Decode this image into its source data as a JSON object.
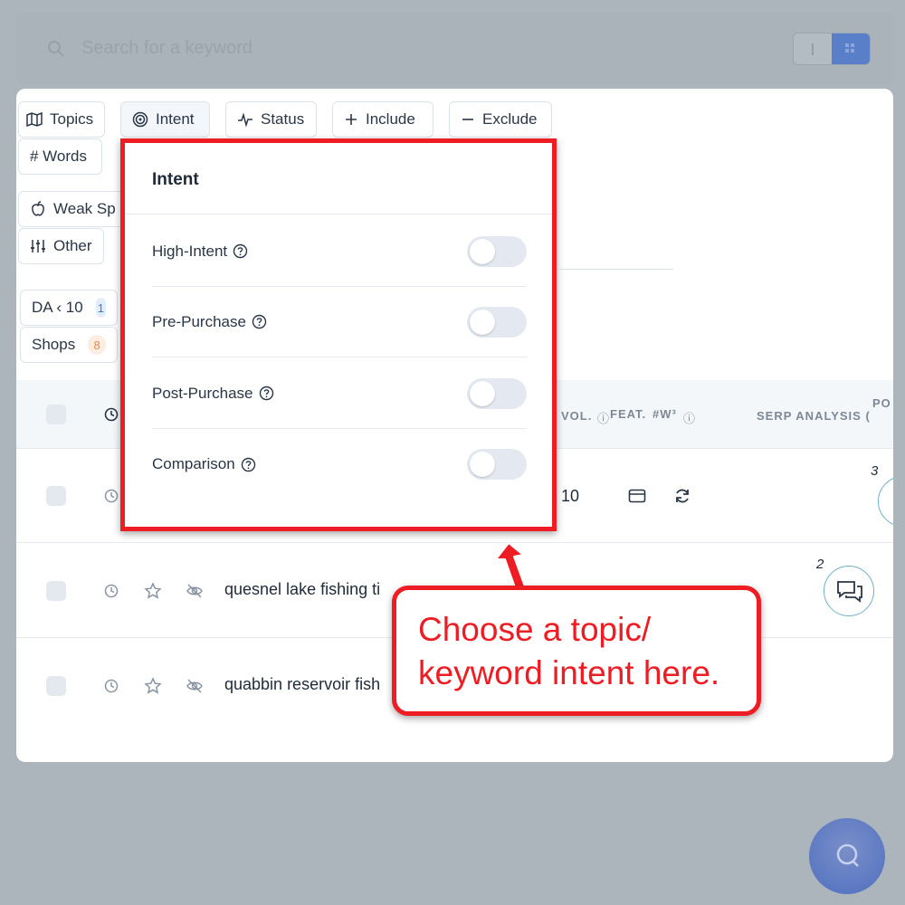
{
  "search": {
    "placeholder": "Search for a keyword"
  },
  "view_toggle": {
    "list_glyph": "|"
  },
  "filters": {
    "topics": "Topics",
    "intent": "Intent",
    "status": "Status",
    "include": "Include",
    "exclude": "Exclude",
    "words": "# Words",
    "weak_spots": "Weak Sp",
    "other": "Other"
  },
  "quick_filters": [
    {
      "label": "DA ‹ 10",
      "count": "1",
      "color": "#3a7bd5"
    },
    {
      "label": "Shops",
      "count": "8",
      "color": "#f0863b"
    }
  ],
  "table": {
    "headers": {
      "vol": "VOL.",
      "feat": "FEAT.",
      "words": "#W³",
      "serp": "SERP ANALYSIS (",
      "po": "PO"
    },
    "rows": [
      {
        "keyword": "",
        "vol": "10",
        "rank": "3"
      },
      {
        "keyword": "quesnel lake fishing ti",
        "rank": "2"
      },
      {
        "keyword": "quabbin reservoir fish"
      }
    ]
  },
  "intent_dropdown": {
    "title": "Intent",
    "options": [
      {
        "label": "High-Intent",
        "enabled": false
      },
      {
        "label": "Pre-Purchase",
        "enabled": false
      },
      {
        "label": "Post-Purchase",
        "enabled": false
      },
      {
        "label": "Comparison",
        "enabled": false
      }
    ]
  },
  "callout": {
    "text": "Choose a topic/ keyword intent here."
  },
  "colors": {
    "annotation_red": "#ee1c23",
    "accent_blue": "#5a7fc9"
  }
}
